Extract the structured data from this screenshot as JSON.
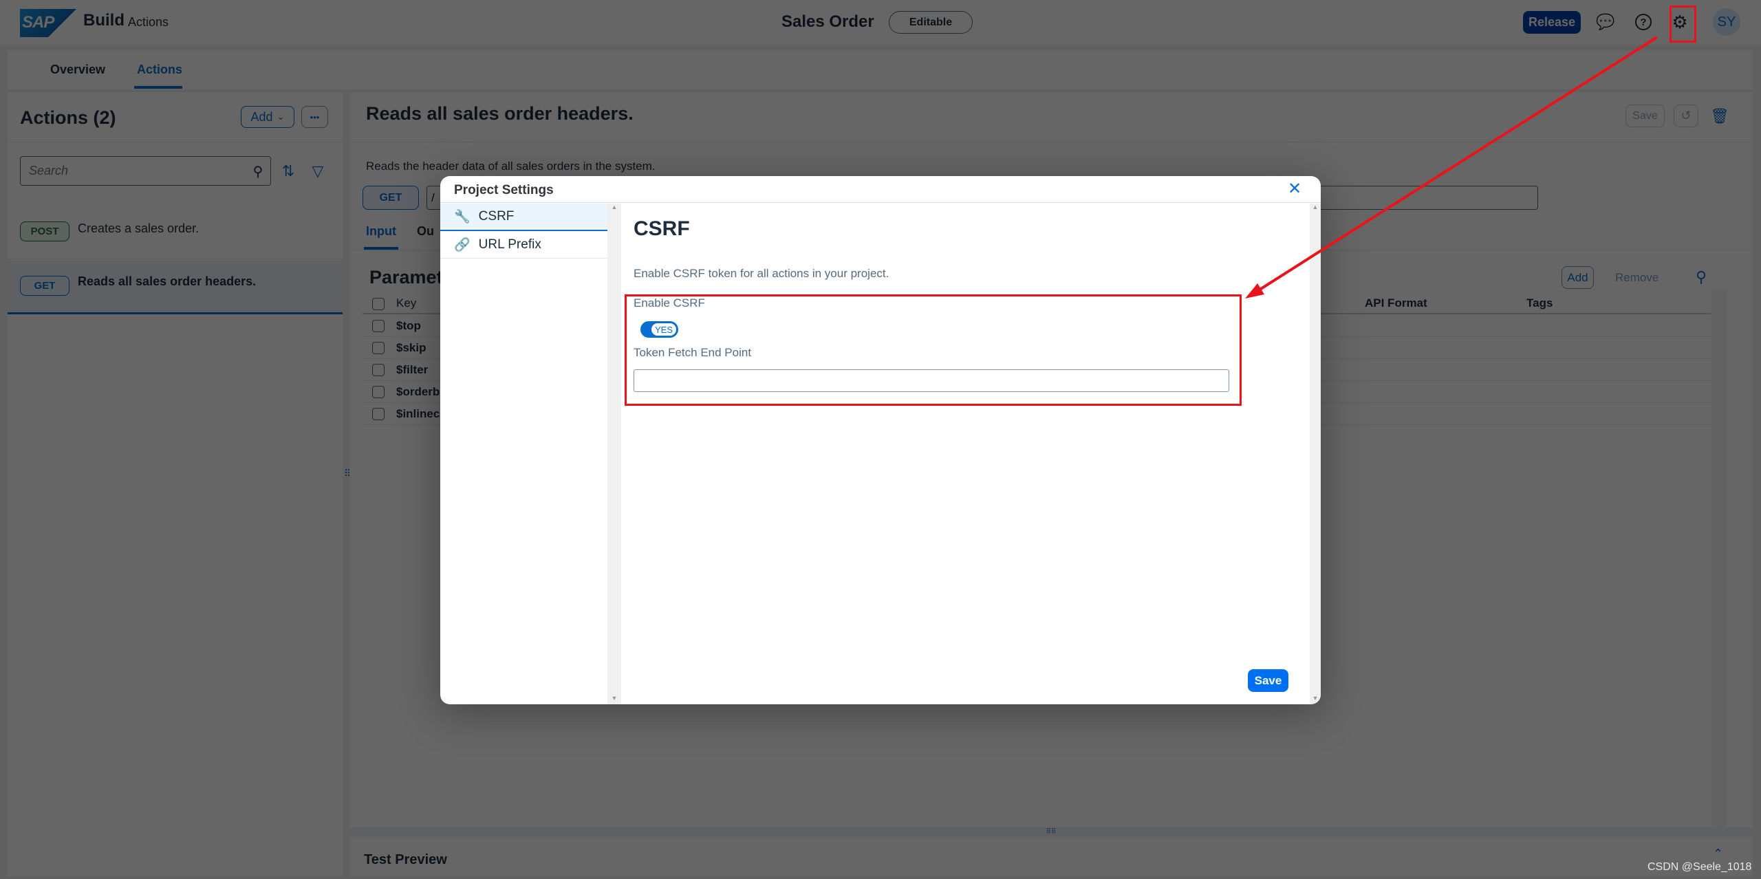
{
  "header": {
    "logo": "SAP",
    "product": "Build",
    "area": "Actions",
    "title": "Sales Order",
    "status_badge": "Editable",
    "release_label": "Release",
    "avatar_initials": "SY",
    "icons": [
      "feedback-icon",
      "help-icon",
      "gear-icon"
    ]
  },
  "tabs": [
    {
      "label": "Overview",
      "active": false
    },
    {
      "label": "Actions",
      "active": true
    }
  ],
  "left": {
    "title": "Actions (2)",
    "add_label": "Add",
    "more_label": "•••",
    "search_placeholder": "Search",
    "items": [
      {
        "method": "POST",
        "text": "Creates a sales order.",
        "selected": false
      },
      {
        "method": "GET",
        "text": "Reads all sales order headers.",
        "selected": true
      }
    ]
  },
  "detail": {
    "title": "Reads all sales order headers.",
    "save_label": "Save",
    "description": "Reads the header data of all sales orders in the system.",
    "method": "GET",
    "url_value": "/",
    "tabs": [
      {
        "label": "Input"
      },
      {
        "label": "Ou"
      }
    ],
    "parameters": {
      "heading": "Paramet",
      "add_label": "Add",
      "remove_label": "Remove",
      "columns": {
        "key": "Key",
        "api_format": "API Format",
        "tags": "Tags"
      },
      "rows": [
        "$top",
        "$skip",
        "$filter",
        "$orderb",
        "$inlinec"
      ]
    },
    "test_preview": "Test Preview"
  },
  "dialog": {
    "title": "Project Settings",
    "nav": [
      {
        "label": "CSRF",
        "icon": "wrench-icon",
        "selected": true
      },
      {
        "label": "URL Prefix",
        "icon": "link-icon",
        "selected": false
      }
    ],
    "heading": "CSRF",
    "description": "Enable CSRF token for all actions in your project.",
    "enable_label": "Enable CSRF",
    "toggle_value": "YES",
    "toggle_on": true,
    "token_label": "Token Fetch End Point",
    "token_value": "",
    "save_label": "Save"
  },
  "watermark": "CSDN @Seele_1018",
  "colors": {
    "accent": "#0a6ed1",
    "release": "#0040b0",
    "annotation": "#e8141b",
    "dialog_save": "#0070f2"
  }
}
